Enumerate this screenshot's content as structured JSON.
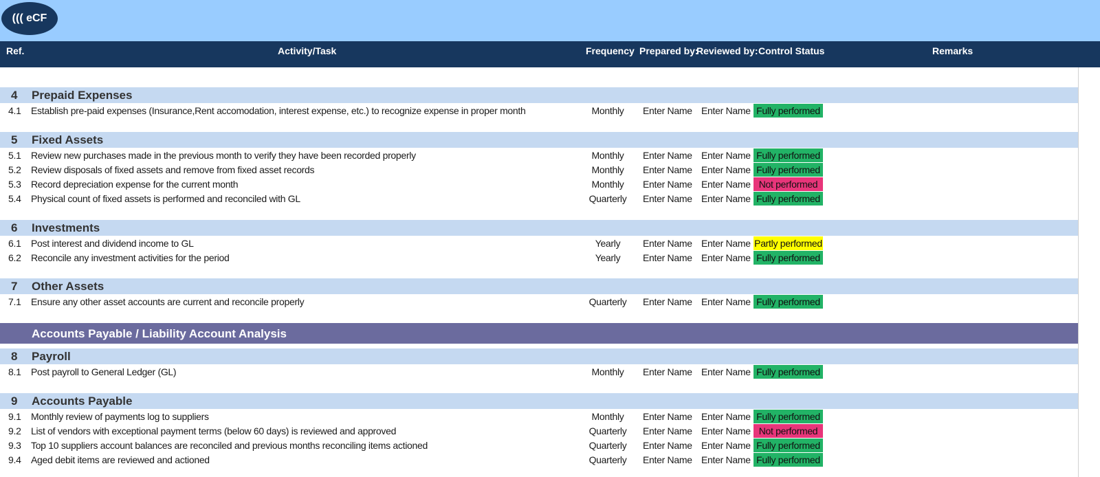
{
  "logo": {
    "text": "((( eCF"
  },
  "header": {
    "ref": "Ref.",
    "task": "Activity/Task",
    "frequency": "Frequency",
    "prepared": "Prepared by:",
    "reviewed": "Reviewed by:",
    "status": "Control Status",
    "remarks": "Remarks"
  },
  "sections": {
    "s4": {
      "num": "4",
      "title": "Prepaid Expenses",
      "rows": [
        {
          "ref": "4.1",
          "task": "Establish pre-paid expenses (Insurance,Rent accomodation, interest expense, etc.) to recognize expense in proper month",
          "frequency": "Monthly",
          "prepared": "Enter Name",
          "reviewed": "Enter Name",
          "status": "Fully performed"
        }
      ]
    },
    "s5": {
      "num": "5",
      "title": "Fixed Assets",
      "rows": [
        {
          "ref": "5.1",
          "task": "Review new purchases made in the previous month to verify they have been recorded properly",
          "frequency": "Monthly",
          "prepared": "Enter Name",
          "reviewed": "Enter Name",
          "status": "Fully performed"
        },
        {
          "ref": "5.2",
          "task": "Review disposals of fixed assets and remove from fixed asset records",
          "frequency": "Monthly",
          "prepared": "Enter Name",
          "reviewed": "Enter Name",
          "status": "Fully performed"
        },
        {
          "ref": "5.3",
          "task": "Record depreciation expense for the current month",
          "frequency": "Monthly",
          "prepared": "Enter Name",
          "reviewed": "Enter Name",
          "status": "Not performed"
        },
        {
          "ref": "5.4",
          "task": "Physical count of fixed assets is performed and reconciled with GL",
          "frequency": "Quarterly",
          "prepared": "Enter Name",
          "reviewed": "Enter Name",
          "status": "Fully performed"
        }
      ]
    },
    "s6": {
      "num": "6",
      "title": "Investments",
      "rows": [
        {
          "ref": "6.1",
          "task": "Post interest and dividend income to GL",
          "frequency": "Yearly",
          "prepared": "Enter Name",
          "reviewed": "Enter Name",
          "status": "Partly performed"
        },
        {
          "ref": "6.2",
          "task": "Reconcile any investment activities for the period",
          "frequency": "Yearly",
          "prepared": "Enter Name",
          "reviewed": "Enter Name",
          "status": "Fully performed"
        }
      ]
    },
    "s7": {
      "num": "7",
      "title": "Other Assets",
      "rows": [
        {
          "ref": "7.1",
          "task": "Ensure any other asset accounts are current and reconcile properly",
          "frequency": "Quarterly",
          "prepared": "Enter Name",
          "reviewed": "Enter Name",
          "status": "Fully performed"
        }
      ]
    },
    "band": {
      "title": "Accounts Payable  / Liability Account Analysis"
    },
    "s8": {
      "num": "8",
      "title": "Payroll",
      "rows": [
        {
          "ref": "8.1",
          "task": "Post payroll to  General Ledger (GL)",
          "frequency": "Monthly",
          "prepared": "Enter Name",
          "reviewed": "Enter Name",
          "status": "Fully performed"
        }
      ]
    },
    "s9": {
      "num": "9",
      "title": "Accounts Payable",
      "rows": [
        {
          "ref": "9.1",
          "task": "Monthly review of payments log to suppliers",
          "frequency": "Monthly",
          "prepared": "Enter Name",
          "reviewed": "Enter Name",
          "status": "Fully performed"
        },
        {
          "ref": "9.2",
          "task": "List of vendors with exceptional payment terms (below 60 days) is reviewed and approved",
          "frequency": "Quarterly",
          "prepared": "Enter Name",
          "reviewed": "Enter Name",
          "status": "Not performed"
        },
        {
          "ref": "9.3",
          "task": "Top 10 suppliers account balances are reconciled and previous months reconciling items actioned",
          "frequency": "Quarterly",
          "prepared": "Enter Name",
          "reviewed": "Enter Name",
          "status": "Fully performed"
        },
        {
          "ref": "9.4",
          "task": "Aged debit items are reviewed and actioned",
          "frequency": "Quarterly",
          "prepared": "Enter Name",
          "reviewed": "Enter Name",
          "status": "Fully performed"
        }
      ]
    }
  },
  "status_colors": {
    "Fully performed": "#22b366",
    "Not performed": "#e8357a",
    "Partly performed": "#ffff00"
  }
}
